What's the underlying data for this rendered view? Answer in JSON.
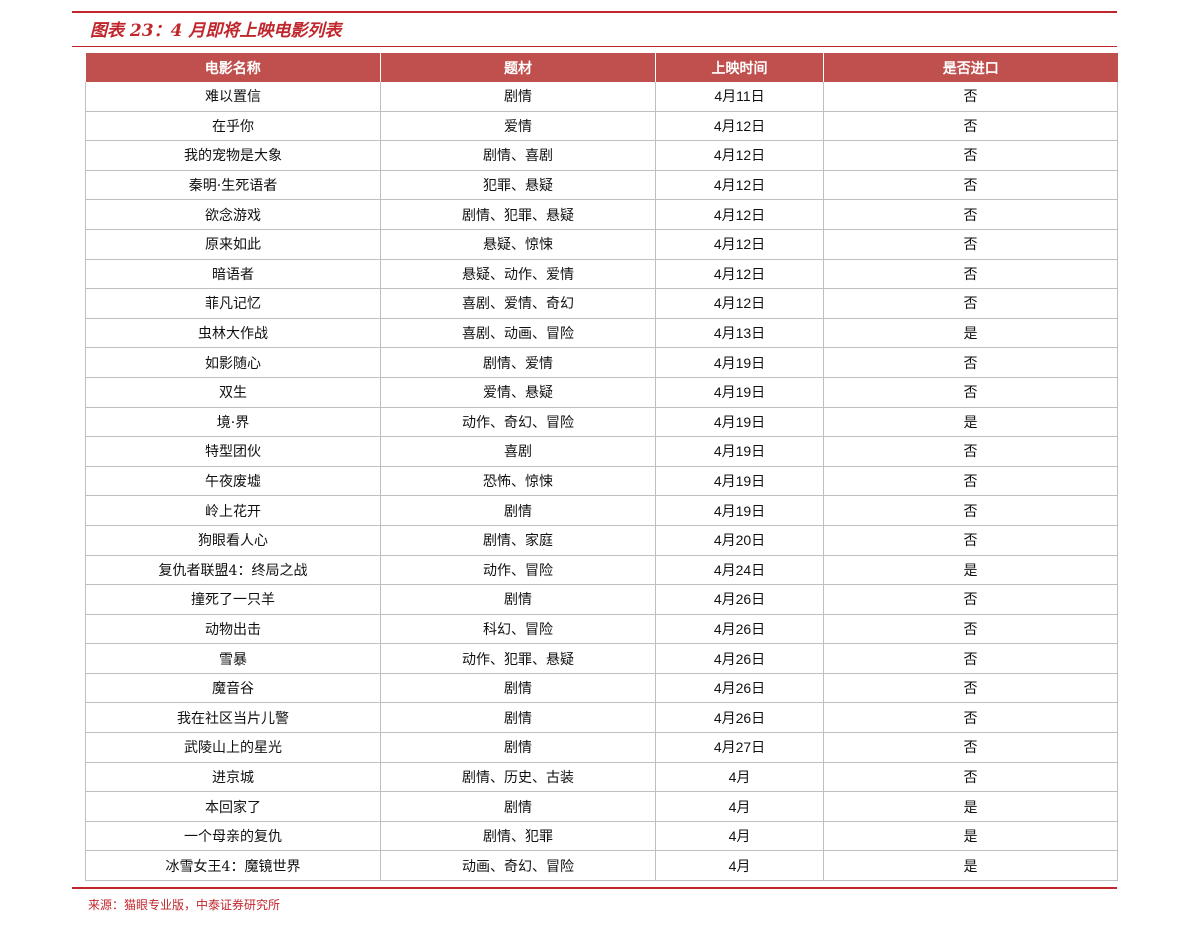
{
  "title": "图表 23：4 月即将上映电影列表",
  "columns": [
    "电影名称",
    "题材",
    "上映时间",
    "是否进口"
  ],
  "rows": [
    [
      "难以置信",
      "剧情",
      "4月11日",
      "否"
    ],
    [
      "在乎你",
      "爱情",
      "4月12日",
      "否"
    ],
    [
      "我的宠物是大象",
      "剧情、喜剧",
      "4月12日",
      "否"
    ],
    [
      "秦明·生死语者",
      "犯罪、悬疑",
      "4月12日",
      "否"
    ],
    [
      "欲念游戏",
      "剧情、犯罪、悬疑",
      "4月12日",
      "否"
    ],
    [
      "原来如此",
      "悬疑、惊悚",
      "4月12日",
      "否"
    ],
    [
      "暗语者",
      "悬疑、动作、爱情",
      "4月12日",
      "否"
    ],
    [
      "菲凡记忆",
      "喜剧、爱情、奇幻",
      "4月12日",
      "否"
    ],
    [
      "虫林大作战",
      "喜剧、动画、冒险",
      "4月13日",
      "是"
    ],
    [
      "如影随心",
      "剧情、爱情",
      "4月19日",
      "否"
    ],
    [
      "双生",
      "爱情、悬疑",
      "4月19日",
      "否"
    ],
    [
      "境·界",
      "动作、奇幻、冒险",
      "4月19日",
      "是"
    ],
    [
      "特型团伙",
      "喜剧",
      "4月19日",
      "否"
    ],
    [
      "午夜废墟",
      "恐怖、惊悚",
      "4月19日",
      "否"
    ],
    [
      "岭上花开",
      "剧情",
      "4月19日",
      "否"
    ],
    [
      "狗眼看人心",
      "剧情、家庭",
      "4月20日",
      "否"
    ],
    [
      "复仇者联盟4：终局之战",
      "动作、冒险",
      "4月24日",
      "是"
    ],
    [
      "撞死了一只羊",
      "剧情",
      "4月26日",
      "否"
    ],
    [
      "动物出击",
      "科幻、冒险",
      "4月26日",
      "否"
    ],
    [
      "雪暴",
      "动作、犯罪、悬疑",
      "4月26日",
      "否"
    ],
    [
      "魔音谷",
      "剧情",
      "4月26日",
      "否"
    ],
    [
      "我在社区当片儿警",
      "剧情",
      "4月26日",
      "否"
    ],
    [
      "武陵山上的星光",
      "剧情",
      "4月27日",
      "否"
    ],
    [
      "进京城",
      "剧情、历史、古装",
      "4月",
      "否"
    ],
    [
      "本回家了",
      "剧情",
      "4月",
      "是"
    ],
    [
      "一个母亲的复仇",
      "剧情、犯罪",
      "4月",
      "是"
    ],
    [
      "冰雪女王4：魔镜世界",
      "动画、奇幻、冒险",
      "4月",
      "是"
    ]
  ],
  "source": "来源：猫眼专业版，中泰证券研究所",
  "colors": {
    "accent": "#c0272d",
    "header_bg": "#c0504d",
    "grid": "#bfbfbf"
  }
}
